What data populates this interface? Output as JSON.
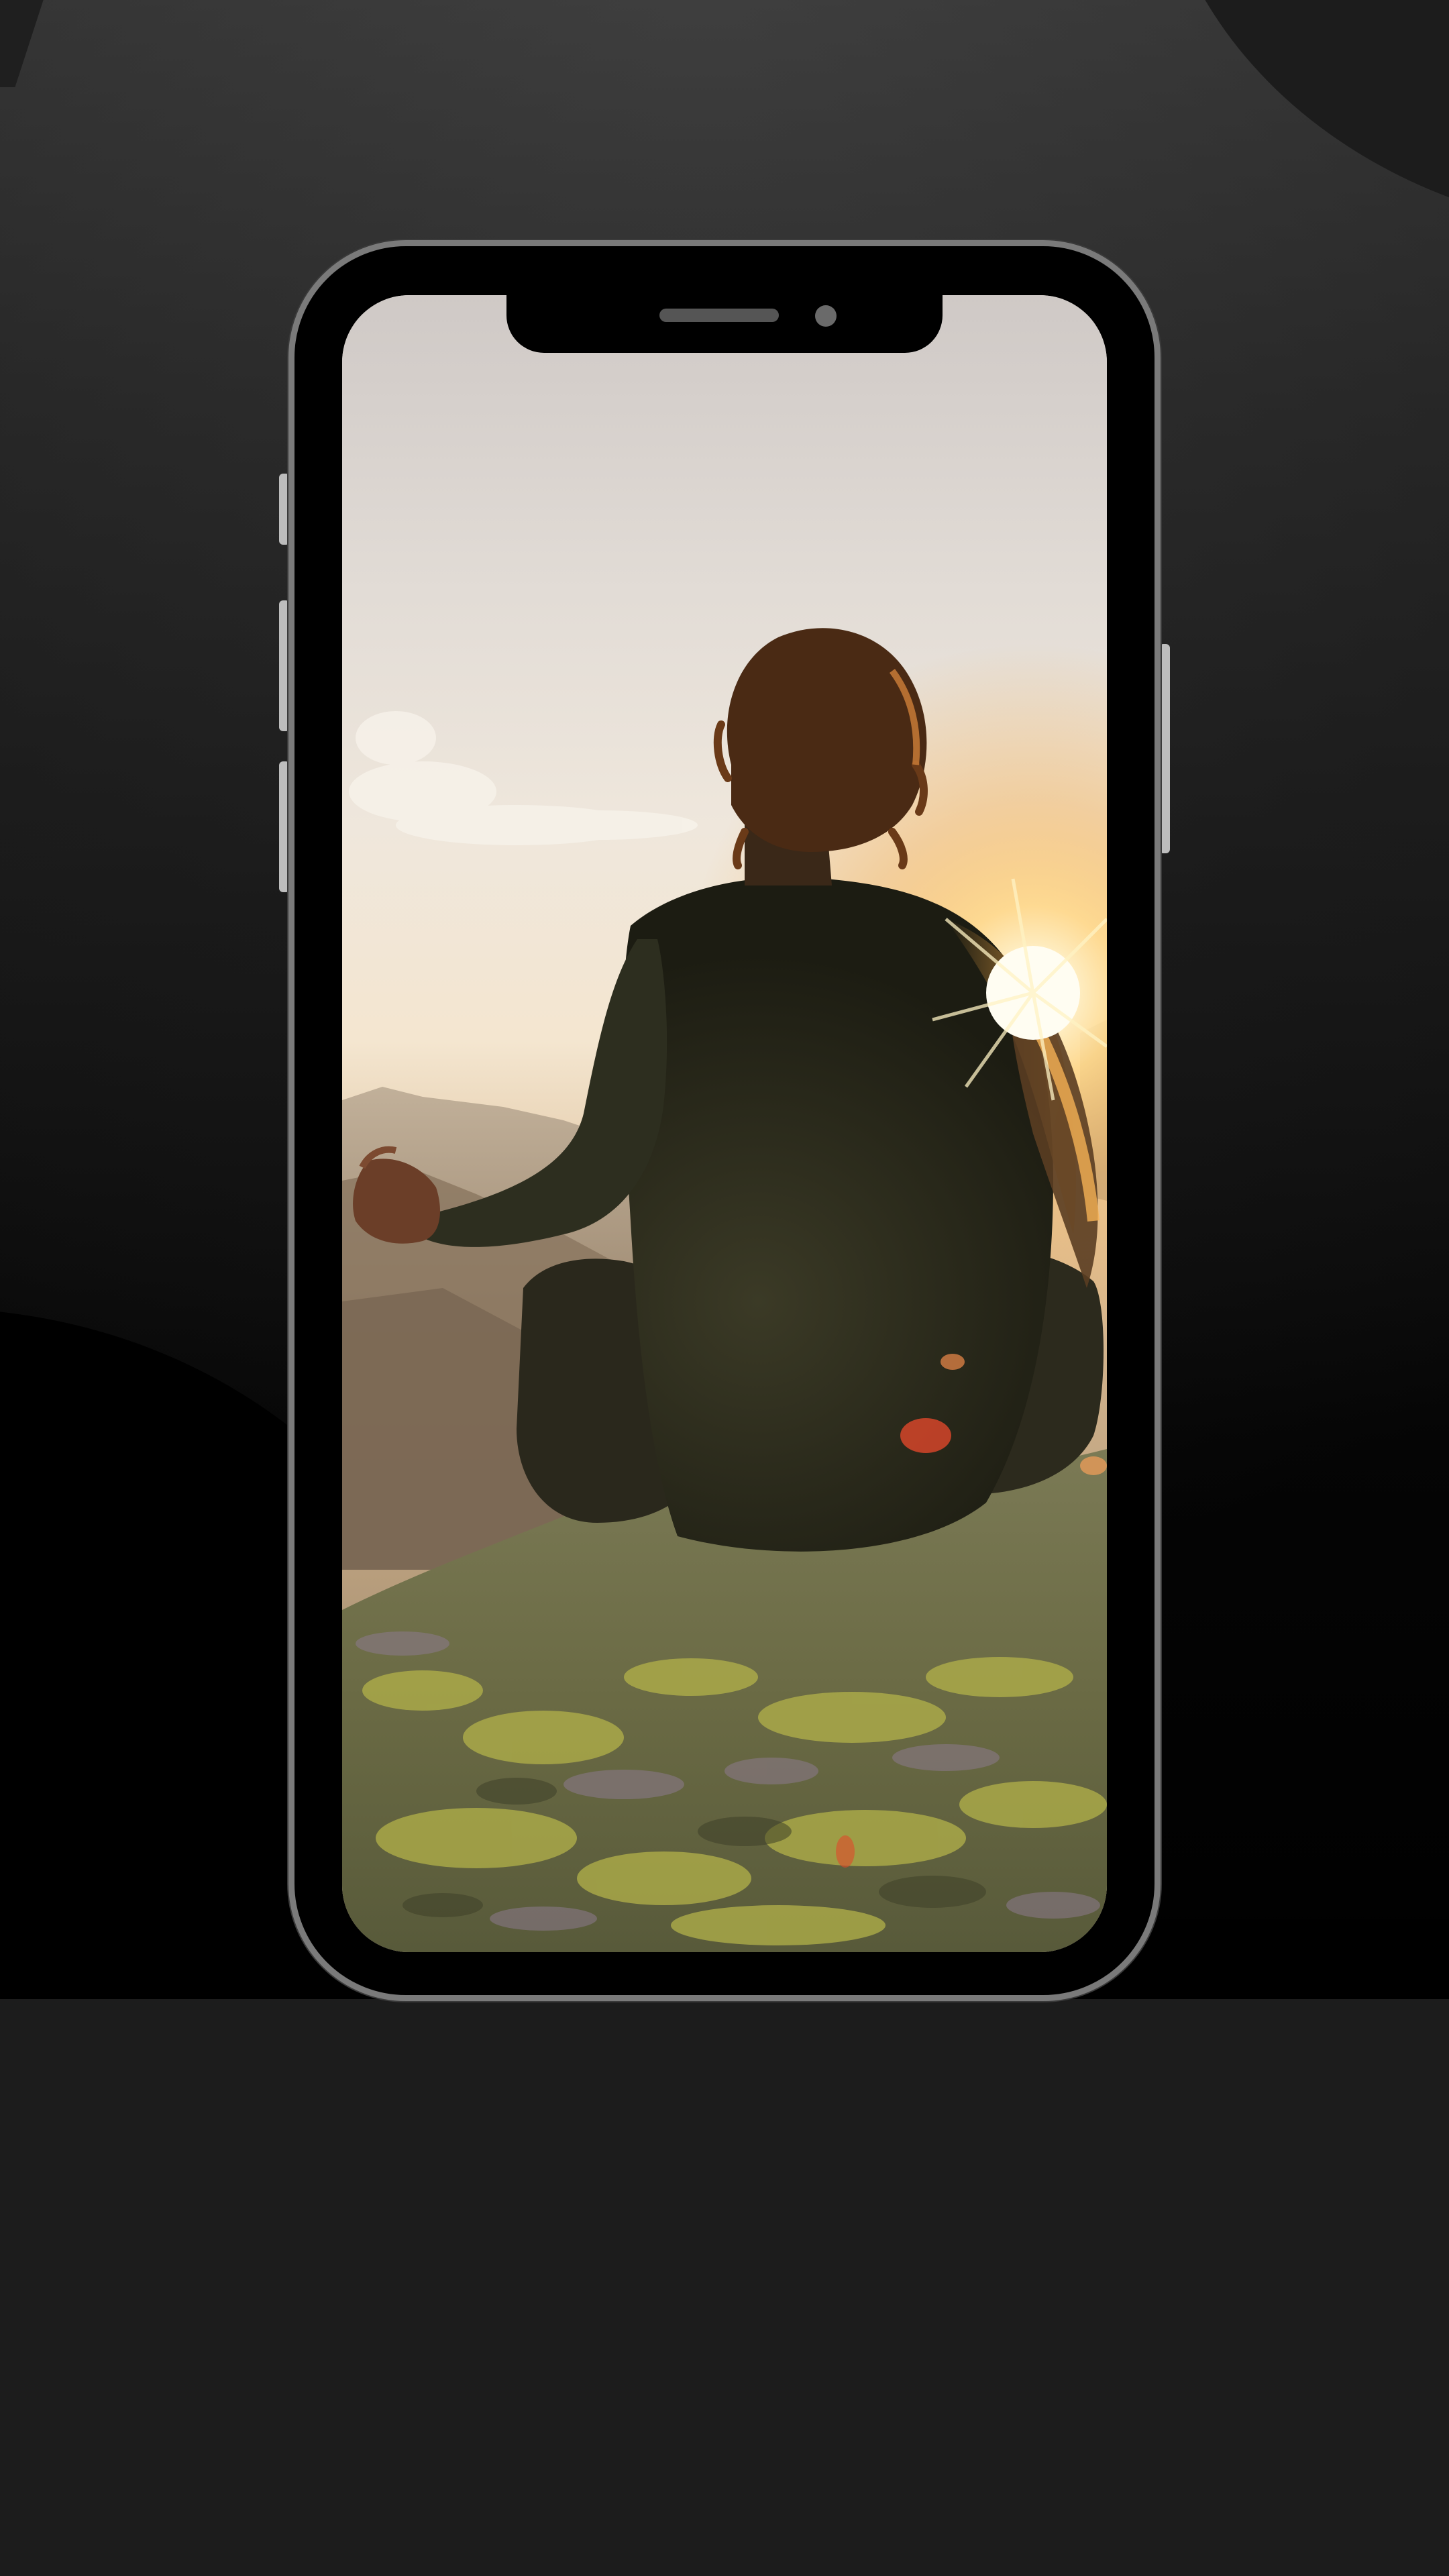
{
  "screen": {
    "wallpaper": {
      "subject": "meditating-person-on-mountain-at-sunset",
      "colors": {
        "sky_top": "#d6d0cc",
        "sky_mid": "#ede4d8",
        "sun": "#fff7e0",
        "sun_glow": "#f6a93a",
        "mountain": "#8b7a6a",
        "rock": "#6f7040",
        "moss": "#b5b34a",
        "body": "#2f3020",
        "hair": "#4a2a14"
      }
    }
  },
  "device": {
    "frame_color": "#7a7a7a",
    "body_color": "#000000",
    "button_color": "#bdbdbd"
  },
  "background": {
    "base_color": "#1c1c1c",
    "panel_top": "#424242",
    "panel_bottom": "#000000"
  }
}
